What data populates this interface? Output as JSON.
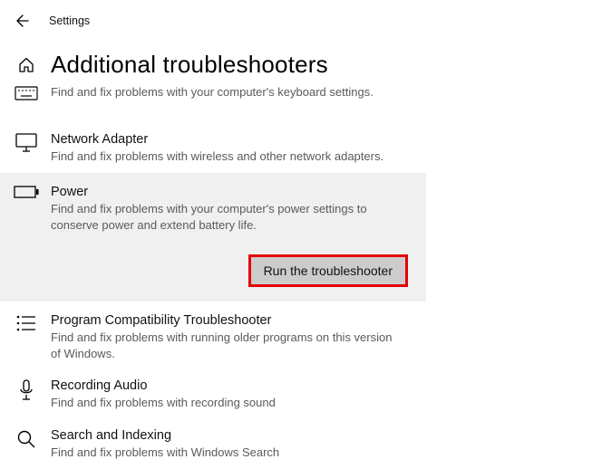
{
  "topbar": {
    "title": "Settings"
  },
  "header": {
    "title": "Additional troubleshooters"
  },
  "items": {
    "keyboard": {
      "title": "",
      "desc": "Find and fix problems with your computer's keyboard settings."
    },
    "network": {
      "title": "Network Adapter",
      "desc": "Find and fix problems with wireless and other network adapters."
    },
    "power": {
      "title": "Power",
      "desc": "Find and fix problems with your computer's power settings to conserve power and extend battery life.",
      "run_label": "Run the troubleshooter"
    },
    "compat": {
      "title": "Program Compatibility Troubleshooter",
      "desc": "Find and fix problems with running older programs on this version of Windows."
    },
    "audio": {
      "title": "Recording Audio",
      "desc": "Find and fix problems with recording sound"
    },
    "search": {
      "title": "Search and Indexing",
      "desc": "Find and fix problems with Windows Search"
    }
  }
}
